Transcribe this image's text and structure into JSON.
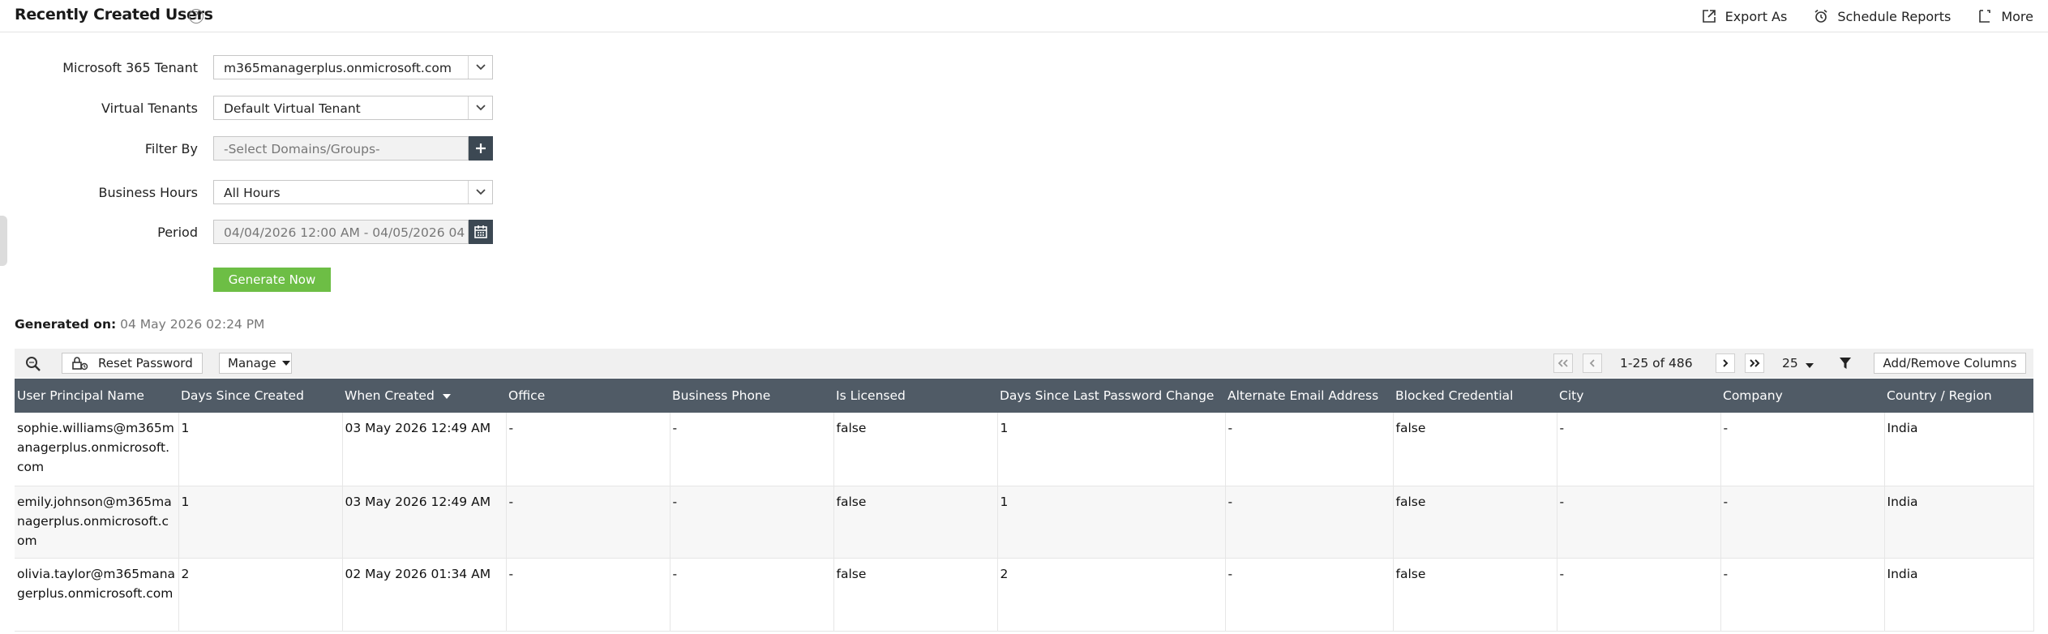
{
  "header": {
    "title": "Recently Created Users",
    "help": "?",
    "actions": [
      {
        "label": "Export As",
        "icon": "export-icon"
      },
      {
        "label": "Schedule Reports",
        "icon": "alarm-clock-icon"
      },
      {
        "label": "More",
        "icon": "more-icon"
      }
    ]
  },
  "form": {
    "tenant_label": "Microsoft 365 Tenant",
    "tenant_value": "m365managerplus.onmicrosoft.com",
    "virtual_label": "Virtual Tenants",
    "virtual_value": "Default Virtual Tenant",
    "filter_label": "Filter By",
    "filter_placeholder": "-Select Domains/Groups-",
    "hours_label": "Business Hours",
    "hours_value": "All Hours",
    "period_label": "Period",
    "period_value": "04/04/2026 12:00 AM - 04/05/2026 04",
    "generate_label": "Generate Now"
  },
  "generated": {
    "label": "Generated on:",
    "time": "04 May 2026 02:24 PM"
  },
  "toolbar": {
    "reset_password": "Reset Password",
    "manage": "Manage",
    "pager_text": "1-25 of 486",
    "page_size": "25",
    "add_remove_columns": "Add/Remove Columns"
  },
  "table": {
    "columns": [
      "User Principal Name",
      "Days Since Created",
      "When Created",
      "Office",
      "Business Phone",
      "Is Licensed",
      "Days Since Last Password Change",
      "Alternate Email Address",
      "Blocked Credential",
      "City",
      "Company",
      "Country / Region"
    ],
    "rows": [
      [
        "sophie.williams@m365managerplus.onmicrosoft.com",
        "1",
        "03 May 2026 12:49 AM",
        "-",
        "-",
        "false",
        "1",
        "-",
        "false",
        "-",
        "-",
        "India"
      ],
      [
        "emily.johnson@m365managerplus.onmicrosoft.com",
        "1",
        "03 May 2026 12:49 AM",
        "-",
        "-",
        "false",
        "1",
        "-",
        "false",
        "-",
        "-",
        "India"
      ],
      [
        "olivia.taylor@m365managerplus.onmicrosoft.com",
        "2",
        "02 May 2026 01:34 AM",
        "-",
        "-",
        "false",
        "2",
        "-",
        "false",
        "-",
        "-",
        "India"
      ]
    ]
  },
  "colors": {
    "header_bg": "#505b66",
    "generate_button": "#6dbe45",
    "dark_button": "#3c4853",
    "toolbar_bg": "#f0f0f0"
  }
}
